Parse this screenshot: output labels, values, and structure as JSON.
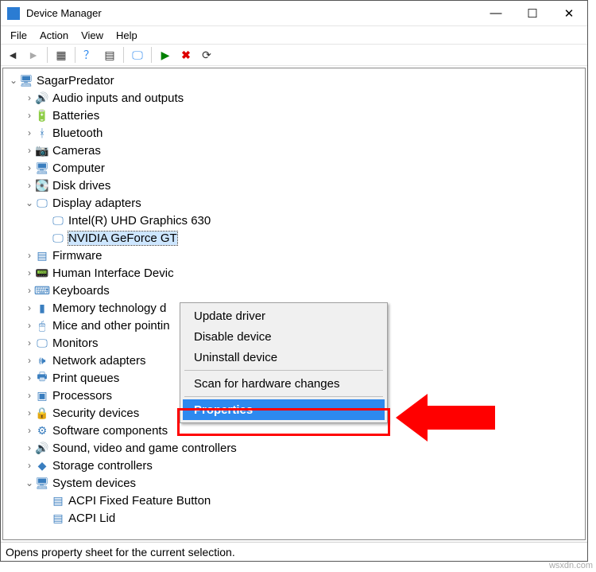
{
  "title": "Device Manager",
  "menu": {
    "file": "File",
    "action": "Action",
    "view": "View",
    "help": "Help"
  },
  "root": "SagarPredator",
  "cats": [
    {
      "label": "Audio inputs and outputs",
      "glyph": "🔊"
    },
    {
      "label": "Batteries",
      "glyph": "🔋"
    },
    {
      "label": "Bluetooth",
      "glyph": "ᚼ"
    },
    {
      "label": "Cameras",
      "glyph": "📷"
    },
    {
      "label": "Computer",
      "glyph": "🖥"
    },
    {
      "label": "Disk drives",
      "glyph": "💽"
    }
  ],
  "display": {
    "label": "Display adapters",
    "child0": "Intel(R) UHD Graphics 630",
    "child1": "NVIDIA GeForce GT"
  },
  "cats2": [
    {
      "label": "Firmware",
      "glyph": "▤"
    },
    {
      "label": "Human Interface Devic",
      "glyph": "📟"
    },
    {
      "label": "Keyboards",
      "glyph": "⌨"
    },
    {
      "label": "Memory technology d",
      "glyph": "▮"
    },
    {
      "label": "Mice and other pointin",
      "glyph": "🖱"
    },
    {
      "label": "Monitors",
      "glyph": "🖵"
    },
    {
      "label": "Network adapters",
      "glyph": "🕪"
    },
    {
      "label": "Print queues",
      "glyph": "🖶"
    },
    {
      "label": "Processors",
      "glyph": "▣"
    },
    {
      "label": "Security devices",
      "glyph": "🔒"
    },
    {
      "label": "Software components",
      "glyph": "⚙"
    },
    {
      "label": "Sound, video and game controllers",
      "glyph": "🔊"
    },
    {
      "label": "Storage controllers",
      "glyph": "◆"
    }
  ],
  "sys": {
    "label": "System devices",
    "child0": "ACPI Fixed Feature Button",
    "child1": "ACPI Lid"
  },
  "ctx": {
    "update": "Update driver",
    "disable": "Disable device",
    "uninstall": "Uninstall device",
    "scan": "Scan for hardware changes",
    "props": "Properties"
  },
  "status": "Opens property sheet for the current selection.",
  "watermark": "wsxdn.com"
}
